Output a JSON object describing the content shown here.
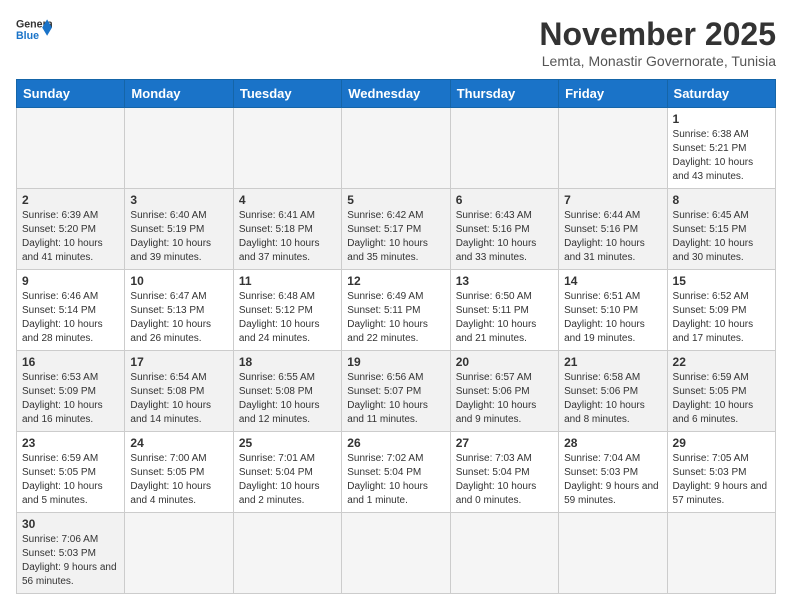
{
  "header": {
    "logo_general": "General",
    "logo_blue": "Blue",
    "month": "November 2025",
    "location": "Lemta, Monastir Governorate, Tunisia"
  },
  "days_of_week": [
    "Sunday",
    "Monday",
    "Tuesday",
    "Wednesday",
    "Thursday",
    "Friday",
    "Saturday"
  ],
  "weeks": [
    [
      {
        "day": "",
        "info": ""
      },
      {
        "day": "",
        "info": ""
      },
      {
        "day": "",
        "info": ""
      },
      {
        "day": "",
        "info": ""
      },
      {
        "day": "",
        "info": ""
      },
      {
        "day": "",
        "info": ""
      },
      {
        "day": "1",
        "info": "Sunrise: 6:38 AM\nSunset: 5:21 PM\nDaylight: 10 hours and 43 minutes."
      }
    ],
    [
      {
        "day": "2",
        "info": "Sunrise: 6:39 AM\nSunset: 5:20 PM\nDaylight: 10 hours and 41 minutes."
      },
      {
        "day": "3",
        "info": "Sunrise: 6:40 AM\nSunset: 5:19 PM\nDaylight: 10 hours and 39 minutes."
      },
      {
        "day": "4",
        "info": "Sunrise: 6:41 AM\nSunset: 5:18 PM\nDaylight: 10 hours and 37 minutes."
      },
      {
        "day": "5",
        "info": "Sunrise: 6:42 AM\nSunset: 5:17 PM\nDaylight: 10 hours and 35 minutes."
      },
      {
        "day": "6",
        "info": "Sunrise: 6:43 AM\nSunset: 5:16 PM\nDaylight: 10 hours and 33 minutes."
      },
      {
        "day": "7",
        "info": "Sunrise: 6:44 AM\nSunset: 5:16 PM\nDaylight: 10 hours and 31 minutes."
      },
      {
        "day": "8",
        "info": "Sunrise: 6:45 AM\nSunset: 5:15 PM\nDaylight: 10 hours and 30 minutes."
      }
    ],
    [
      {
        "day": "9",
        "info": "Sunrise: 6:46 AM\nSunset: 5:14 PM\nDaylight: 10 hours and 28 minutes."
      },
      {
        "day": "10",
        "info": "Sunrise: 6:47 AM\nSunset: 5:13 PM\nDaylight: 10 hours and 26 minutes."
      },
      {
        "day": "11",
        "info": "Sunrise: 6:48 AM\nSunset: 5:12 PM\nDaylight: 10 hours and 24 minutes."
      },
      {
        "day": "12",
        "info": "Sunrise: 6:49 AM\nSunset: 5:11 PM\nDaylight: 10 hours and 22 minutes."
      },
      {
        "day": "13",
        "info": "Sunrise: 6:50 AM\nSunset: 5:11 PM\nDaylight: 10 hours and 21 minutes."
      },
      {
        "day": "14",
        "info": "Sunrise: 6:51 AM\nSunset: 5:10 PM\nDaylight: 10 hours and 19 minutes."
      },
      {
        "day": "15",
        "info": "Sunrise: 6:52 AM\nSunset: 5:09 PM\nDaylight: 10 hours and 17 minutes."
      }
    ],
    [
      {
        "day": "16",
        "info": "Sunrise: 6:53 AM\nSunset: 5:09 PM\nDaylight: 10 hours and 16 minutes."
      },
      {
        "day": "17",
        "info": "Sunrise: 6:54 AM\nSunset: 5:08 PM\nDaylight: 10 hours and 14 minutes."
      },
      {
        "day": "18",
        "info": "Sunrise: 6:55 AM\nSunset: 5:08 PM\nDaylight: 10 hours and 12 minutes."
      },
      {
        "day": "19",
        "info": "Sunrise: 6:56 AM\nSunset: 5:07 PM\nDaylight: 10 hours and 11 minutes."
      },
      {
        "day": "20",
        "info": "Sunrise: 6:57 AM\nSunset: 5:06 PM\nDaylight: 10 hours and 9 minutes."
      },
      {
        "day": "21",
        "info": "Sunrise: 6:58 AM\nSunset: 5:06 PM\nDaylight: 10 hours and 8 minutes."
      },
      {
        "day": "22",
        "info": "Sunrise: 6:59 AM\nSunset: 5:05 PM\nDaylight: 10 hours and 6 minutes."
      }
    ],
    [
      {
        "day": "23",
        "info": "Sunrise: 6:59 AM\nSunset: 5:05 PM\nDaylight: 10 hours and 5 minutes."
      },
      {
        "day": "24",
        "info": "Sunrise: 7:00 AM\nSunset: 5:05 PM\nDaylight: 10 hours and 4 minutes."
      },
      {
        "day": "25",
        "info": "Sunrise: 7:01 AM\nSunset: 5:04 PM\nDaylight: 10 hours and 2 minutes."
      },
      {
        "day": "26",
        "info": "Sunrise: 7:02 AM\nSunset: 5:04 PM\nDaylight: 10 hours and 1 minute."
      },
      {
        "day": "27",
        "info": "Sunrise: 7:03 AM\nSunset: 5:04 PM\nDaylight: 10 hours and 0 minutes."
      },
      {
        "day": "28",
        "info": "Sunrise: 7:04 AM\nSunset: 5:03 PM\nDaylight: 9 hours and 59 minutes."
      },
      {
        "day": "29",
        "info": "Sunrise: 7:05 AM\nSunset: 5:03 PM\nDaylight: 9 hours and 57 minutes."
      }
    ],
    [
      {
        "day": "30",
        "info": "Sunrise: 7:06 AM\nSunset: 5:03 PM\nDaylight: 9 hours and 56 minutes."
      },
      {
        "day": "",
        "info": ""
      },
      {
        "day": "",
        "info": ""
      },
      {
        "day": "",
        "info": ""
      },
      {
        "day": "",
        "info": ""
      },
      {
        "day": "",
        "info": ""
      },
      {
        "day": "",
        "info": ""
      }
    ]
  ]
}
